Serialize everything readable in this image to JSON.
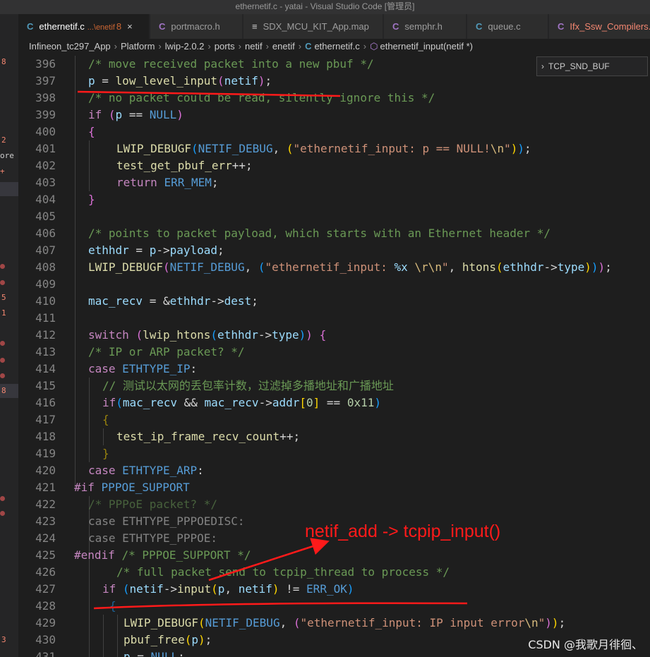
{
  "window": {
    "title": "ethernetif.c - yatai - Visual Studio Code [管理员]"
  },
  "tabs": [
    {
      "icon": "C",
      "label": "ethernetif.c",
      "description": "...\\enetif",
      "badge": "8",
      "close": "×",
      "active": true
    },
    {
      "icon": "C",
      "label": "portmacro.h"
    },
    {
      "icon": "≡",
      "label": "SDX_MCU_KIT_App.map"
    },
    {
      "icon": "C",
      "label": "semphr.h"
    },
    {
      "icon": "C",
      "label": "queue.c"
    },
    {
      "icon": "C",
      "label": "Ifx_Ssw_Compilers.h"
    }
  ],
  "breadcrumb": {
    "items": [
      "Infineon_tc297_App",
      "Platform",
      "lwip-2.0.2",
      "ports",
      "netif",
      "enetif"
    ],
    "file_icon": "C",
    "file": "ethernetif.c",
    "symbol_icon": "⬡",
    "symbol": "ethernetif_input(netif *)"
  },
  "left_strip": {
    "markers": [
      "8",
      "2",
      "ore",
      "+",
      "5",
      "1",
      "8",
      "3"
    ]
  },
  "suggestion": {
    "chevron": "›",
    "label": "TCP_SND_BUF"
  },
  "code_lines": [
    {
      "n": "396"
    },
    {
      "n": "397"
    },
    {
      "n": "398"
    },
    {
      "n": "399"
    },
    {
      "n": "400"
    },
    {
      "n": "401"
    },
    {
      "n": "402"
    },
    {
      "n": "403"
    },
    {
      "n": "404"
    },
    {
      "n": "405"
    },
    {
      "n": "406"
    },
    {
      "n": "407"
    },
    {
      "n": "408"
    },
    {
      "n": "409"
    },
    {
      "n": "410"
    },
    {
      "n": "411"
    },
    {
      "n": "412"
    },
    {
      "n": "413"
    },
    {
      "n": "414"
    },
    {
      "n": "415"
    },
    {
      "n": "416"
    },
    {
      "n": "417"
    },
    {
      "n": "418"
    },
    {
      "n": "419"
    },
    {
      "n": "420"
    },
    {
      "n": "421"
    },
    {
      "n": "422"
    },
    {
      "n": "423"
    },
    {
      "n": "424"
    },
    {
      "n": "425"
    },
    {
      "n": "426"
    },
    {
      "n": "427"
    },
    {
      "n": "428"
    },
    {
      "n": "429"
    },
    {
      "n": "430"
    },
    {
      "n": "431"
    }
  ],
  "code": {
    "l396": "/* move received packet into a new pbuf */",
    "l398": "/* no packet could be read, silently ignore this */",
    "l401_str": "\"ethernetif_input: p == NULL!",
    "l401_esc": "\\n",
    "l406": "/* points to packet payload, which starts with an Ethernet header */",
    "l408_str": "\"ethernetif_input: ",
    "l408_fmt": "%x",
    "l408_esc": " \\r\\n",
    "l413": "/* IP or ARP packet? */",
    "l415": "// 测试以太网的丢包率计数，过滤掉多播地址和广播地址",
    "l416_num1": "0",
    "l416_num2": "0x11",
    "l422": "/* PPPoE packet? */",
    "l425": "/* PPPOE_SUPPORT */",
    "l426": "/* full packet send to tcpip_thread to process */",
    "l429_str": "\"ethernetif_input: IP input error",
    "l429_esc": "\\n"
  },
  "annotation": {
    "text": "netif_add -> tcpip_input()",
    "color": "#ff1a1a"
  },
  "watermark": "CSDN @我歌月徘徊、",
  "colors": {
    "background": "#1e1e1e",
    "keyword": "#569cd6",
    "comment": "#6a9955",
    "function": "#dcdcaa",
    "string": "#ce9178",
    "number": "#b5cea8",
    "preprocessor": "#c586c0",
    "annotation": "#ff1a1a"
  }
}
